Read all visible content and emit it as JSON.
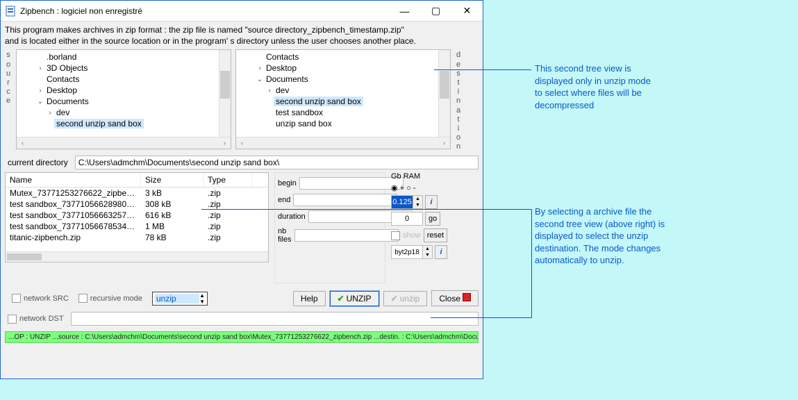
{
  "window": {
    "title": "Zipbench : logiciel non enregistré"
  },
  "description": {
    "line1": "This program makes archives in zip format : the zip file is named \"source directory_zipbench_timestamp.zip\"",
    "line2": "and is located either in the source location or in the program' s directory unless the user chooses another place."
  },
  "side_labels": {
    "source": "source",
    "destination": "destination"
  },
  "source_tree": {
    "items": [
      {
        "label": ".borland",
        "indent": 2,
        "exp": ""
      },
      {
        "label": "3D Objects",
        "indent": 2,
        "exp": "›"
      },
      {
        "label": "Contacts",
        "indent": 2,
        "exp": ""
      },
      {
        "label": "Desktop",
        "indent": 2,
        "exp": "›"
      },
      {
        "label": "Documents",
        "indent": 2,
        "exp": "⌄",
        "open": true
      },
      {
        "label": "dev",
        "indent": 3,
        "exp": "›"
      },
      {
        "label": "second unzip sand box",
        "indent": 3,
        "exp": "",
        "selected": true
      }
    ]
  },
  "dest_tree": {
    "items": [
      {
        "label": "Contacts",
        "indent": 2,
        "exp": ""
      },
      {
        "label": "Desktop",
        "indent": 2,
        "exp": "›"
      },
      {
        "label": "Documents",
        "indent": 2,
        "exp": "⌄",
        "open": true
      },
      {
        "label": "dev",
        "indent": 3,
        "exp": "›"
      },
      {
        "label": "second unzip sand box",
        "indent": 3,
        "exp": "",
        "selected": true
      },
      {
        "label": "test  sandbox",
        "indent": 3,
        "exp": ""
      },
      {
        "label": "unzip sand box",
        "indent": 3,
        "exp": ""
      }
    ]
  },
  "curdir": {
    "label": "current directory",
    "value": "C:\\Users\\admchm\\Documents\\second unzip sand box\\"
  },
  "filelist": {
    "headers": {
      "name": "Name",
      "size": "Size",
      "type": "Type"
    },
    "rows": [
      {
        "name": "Mutex_73771253276622_zipbenc...",
        "size": "3 kB",
        "type": ".zip"
      },
      {
        "name": "test  sandbox_73771056628980_z...",
        "size": "308 kB",
        "type": ".zip"
      },
      {
        "name": "test  sandbox_73771056663257_z...",
        "size": "616 kB",
        "type": ".zip"
      },
      {
        "name": "test  sandbox_73771056678534_z...",
        "size": "1 MB",
        "type": ".zip"
      },
      {
        "name": "titanic-zipbench.zip",
        "size": "78 kB",
        "type": ".zip"
      }
    ]
  },
  "meta": {
    "begin": {
      "label": "begin",
      "value": ""
    },
    "end": {
      "label": "end",
      "value": ""
    },
    "duration": {
      "label": "duration",
      "value": ""
    },
    "nbfiles": {
      "label": "nb files",
      "value": ""
    }
  },
  "ram": {
    "title": "Gb RAM",
    "value1": "0.125",
    "value2": "0",
    "go_label": "go",
    "show_label": "show",
    "reset_label": "reset",
    "select_value": "byt2p18"
  },
  "buttons": {
    "help": "Help",
    "unzip_primary": "UNZIP",
    "unzip_secondary": "unzip",
    "close": "Close"
  },
  "controls": {
    "network_src": "network SRC",
    "recursive": "recursive mode",
    "mode_value": "unzip",
    "network_dst": "network DST"
  },
  "status": "...OP : UNZIP        ...source : C:\\Users\\admchm\\Documents\\second unzip sand box\\Mutex_73771253276622_zipbench.zip       ...destin. : C:\\Users\\admchm\\Documents\\second unzip s",
  "annotations": {
    "a1": "This second tree view is displayed only in unzip mode to select where files will be decompressed",
    "a2": "By selecting a archive file the second tree view (above right) is displayed to select the unzip destination. The mode changes automatically to unzip."
  }
}
